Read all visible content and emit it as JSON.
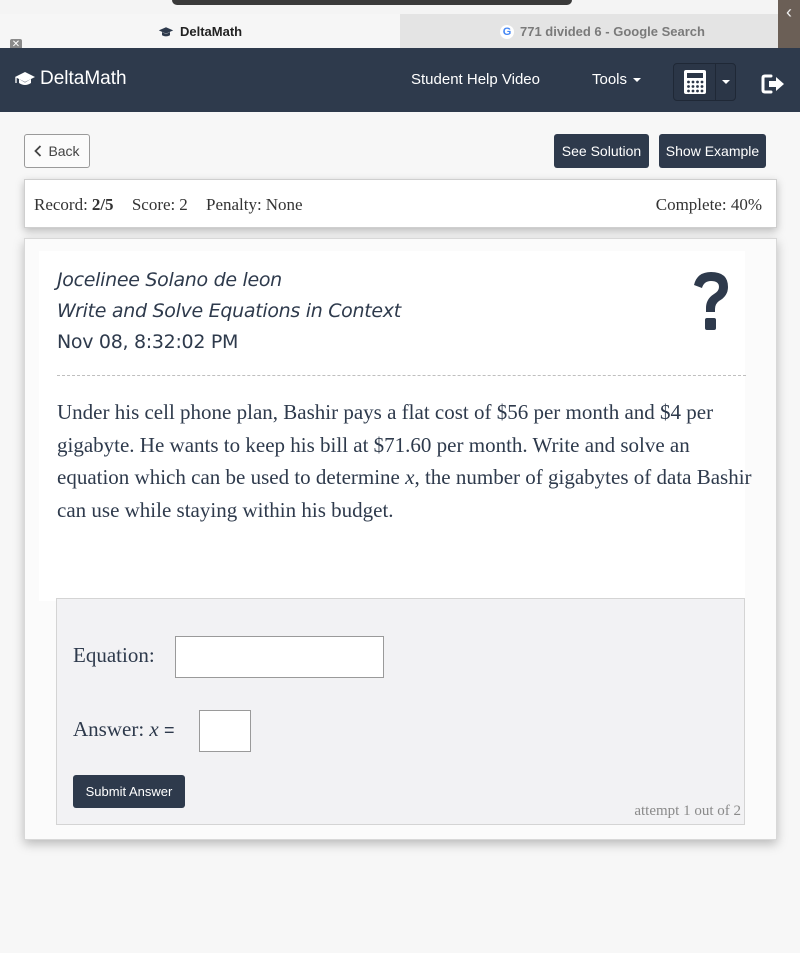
{
  "browser": {
    "tabs": [
      {
        "title": "DeltaMath",
        "icon": "graduation-cap-icon",
        "active": true
      },
      {
        "title": "771 divided 6 - Google Search",
        "icon": "google-icon",
        "active": false
      }
    ],
    "close_glyph": "✕",
    "side_handle_glyph": "‹"
  },
  "navbar": {
    "brand": "DeltaMath",
    "links": {
      "help_video": "Student Help Video",
      "tools": "Tools"
    }
  },
  "actions": {
    "back": "Back",
    "see_solution": "See Solution",
    "show_example": "Show Example"
  },
  "record_bar": {
    "record_label": "Record:",
    "record_value": "2/5",
    "score_label": "Score:",
    "score_value": "2",
    "penalty_label": "Penalty:",
    "penalty_value": "None",
    "complete_label": "Complete:",
    "complete_value": "40%"
  },
  "problem": {
    "student_name": "Jocelinee Solano de leon",
    "assignment": "Write and Solve Equations in Context",
    "timestamp": "Nov 08, 8:32:02 PM",
    "text_before_var": "Under his cell phone plan, Bashir pays a flat cost of $56 per month and $4 per gigabyte. He wants to keep his bill at $71.60 per month. Write and solve an equation which can be used to determine ",
    "variable": "x",
    "text_after_var": ", the number of gigabytes of data Bashir can use while staying within his budget."
  },
  "answer": {
    "equation_label": "Equation:",
    "equation_value": "",
    "answer_label": "Answer:",
    "answer_var": "x",
    "answer_eq": "=",
    "answer_value": "",
    "submit": "Submit Answer",
    "attempt": "attempt 1 out of 2"
  },
  "colors": {
    "navy": "#2e3a4c",
    "page_bg": "#f7f7f7",
    "answer_bg": "#f2f2f4"
  }
}
